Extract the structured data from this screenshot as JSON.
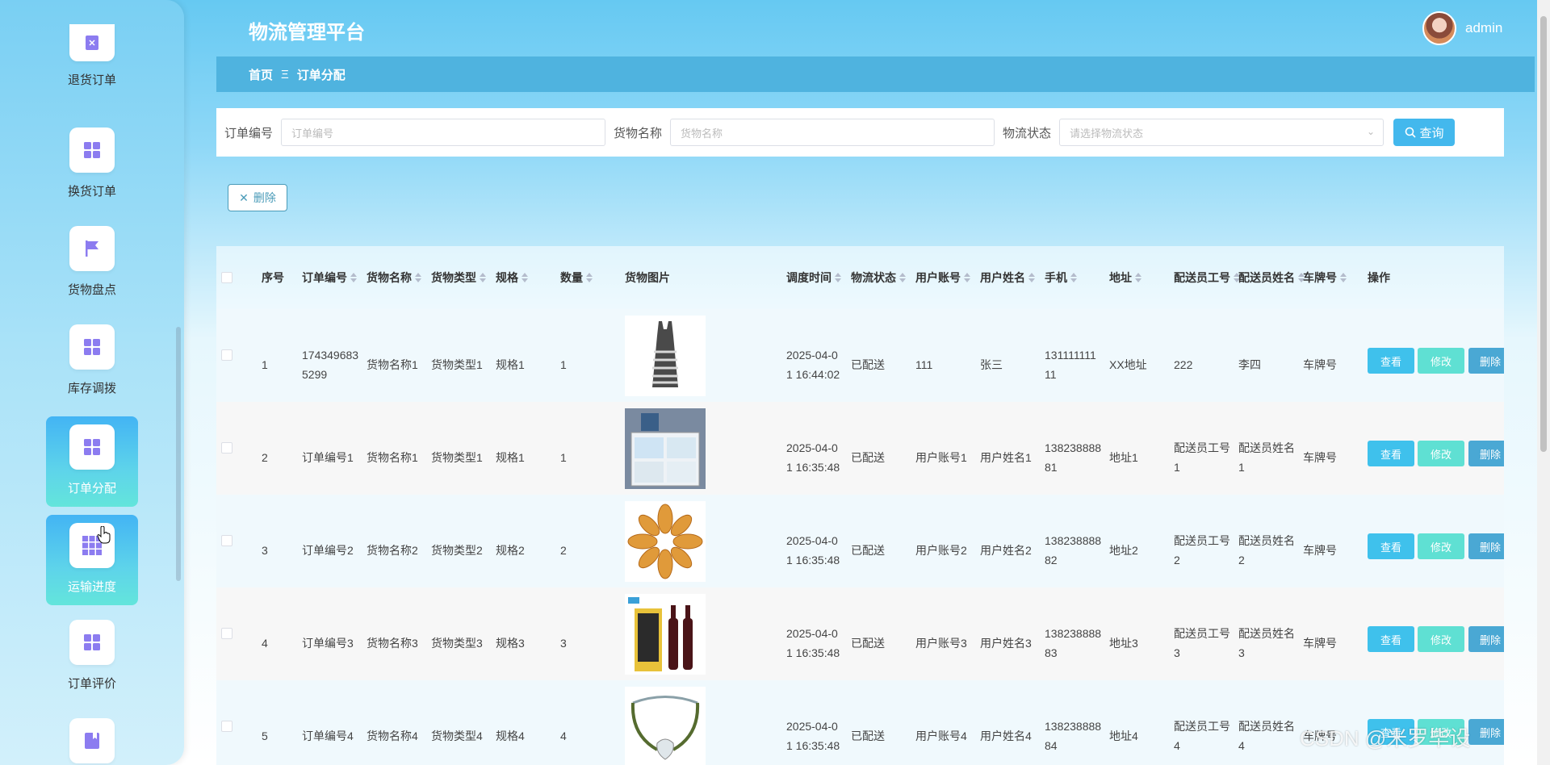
{
  "app": {
    "title": "物流管理平台",
    "user": "admin"
  },
  "breadcrumb": {
    "home": "首页",
    "sep": "Ξ",
    "current": "订单分配"
  },
  "sidebar": {
    "items": [
      {
        "label": "退货订单",
        "icon": "clipboard-icon"
      },
      {
        "label": "换货订单",
        "icon": "grid-icon"
      },
      {
        "label": "货物盘点",
        "icon": "flag-icon"
      },
      {
        "label": "库存调拨",
        "icon": "grid-icon"
      },
      {
        "label": "订单分配",
        "icon": "grid-icon",
        "active": true
      },
      {
        "label": "运输进度",
        "icon": "grid-icon",
        "hover": true
      },
      {
        "label": "订单评价",
        "icon": "grid-icon"
      },
      {
        "label": "",
        "icon": "book-icon"
      }
    ]
  },
  "search": {
    "order_label": "订单编号",
    "order_placeholder": "订单编号",
    "goods_label": "货物名称",
    "goods_placeholder": "货物名称",
    "status_label": "物流状态",
    "status_placeholder": "请选择物流状态",
    "query_label": "查询"
  },
  "toolbar": {
    "delete_label": "删除"
  },
  "table": {
    "headers": {
      "index": "序号",
      "order_no": "订单编号",
      "goods_name": "货物名称",
      "goods_type": "货物类型",
      "spec": "规格",
      "qty": "数量",
      "image": "货物图片",
      "time": "调度时间",
      "status": "物流状态",
      "account": "用户账号",
      "username": "用户姓名",
      "phone": "手机",
      "address": "地址",
      "courier_id": "配送员工号",
      "courier_name": "配送员姓名",
      "plate": "车牌号",
      "ops": "操作"
    },
    "actions": {
      "view": "查看",
      "edit": "修改",
      "delete": "删除"
    },
    "rows": [
      {
        "index": "1",
        "order_no_1": "174349683",
        "order_no_2": "5299",
        "goods_name": "货物名称1",
        "goods_type": "货物类型1",
        "spec": "规格1",
        "qty": "1",
        "image": "dress",
        "time_1": "2025-04-0",
        "time_2": "1 16:44:02",
        "status": "已配送",
        "account": "111",
        "username": "张三",
        "phone_1": "131111111",
        "phone_2": "11",
        "address": "XX地址",
        "courier_id_1": "222",
        "courier_id_2": "",
        "courier_name_1": "李四",
        "courier_name_2": "",
        "plate": "车牌号"
      },
      {
        "index": "2",
        "order_no_1": "订单编号1",
        "order_no_2": "",
        "goods_name": "货物名称1",
        "goods_type": "货物类型1",
        "spec": "规格1",
        "qty": "1",
        "image": "storage-box",
        "time_1": "2025-04-0",
        "time_2": "1 16:35:48",
        "status": "已配送",
        "account": "用户账号1",
        "username": "用户姓名1",
        "phone_1": "138238888",
        "phone_2": "81",
        "address": "地址1",
        "courier_id_1": "配送员工号",
        "courier_id_2": "1",
        "courier_name_1": "配送员姓名",
        "courier_name_2": "1",
        "plate": "车牌号"
      },
      {
        "index": "3",
        "order_no_1": "订单编号2",
        "order_no_2": "",
        "goods_name": "货物名称2",
        "goods_type": "货物类型2",
        "spec": "规格2",
        "qty": "2",
        "image": "snack",
        "time_1": "2025-04-0",
        "time_2": "1 16:35:48",
        "status": "已配送",
        "account": "用户账号2",
        "username": "用户姓名2",
        "phone_1": "138238888",
        "phone_2": "82",
        "address": "地址2",
        "courier_id_1": "配送员工号",
        "courier_id_2": "2",
        "courier_name_1": "配送员姓名",
        "courier_name_2": "2",
        "plate": "车牌号"
      },
      {
        "index": "4",
        "order_no_1": "订单编号3",
        "order_no_2": "",
        "goods_name": "货物名称3",
        "goods_type": "货物类型3",
        "spec": "规格3",
        "qty": "3",
        "image": "wine",
        "time_1": "2025-04-0",
        "time_2": "1 16:35:48",
        "status": "已配送",
        "account": "用户账号3",
        "username": "用户姓名3",
        "phone_1": "138238888",
        "phone_2": "83",
        "address": "地址3",
        "courier_id_1": "配送员工号",
        "courier_id_2": "3",
        "courier_name_1": "配送员姓名",
        "courier_name_2": "3",
        "plate": "车牌号"
      },
      {
        "index": "5",
        "order_no_1": "订单编号4",
        "order_no_2": "",
        "goods_name": "货物名称4",
        "goods_type": "货物类型4",
        "spec": "规格4",
        "qty": "4",
        "image": "bracelet",
        "time_1": "2025-04-0",
        "time_2": "1 16:35:48",
        "status": "已配送",
        "account": "用户账号4",
        "username": "用户姓名4",
        "phone_1": "138238888",
        "phone_2": "84",
        "address": "地址4",
        "courier_id_1": "配送员工号",
        "courier_id_2": "4",
        "courier_name_1": "配送员姓名",
        "courier_name_2": "4",
        "plate": "车牌号"
      }
    ]
  },
  "watermark": "CSDN @米罗毕设",
  "colors": {
    "accent": "#43b8ed",
    "edit": "#5fe0d3",
    "breadcrumb": "#4fb3df",
    "icon": "#8c7cf0"
  }
}
